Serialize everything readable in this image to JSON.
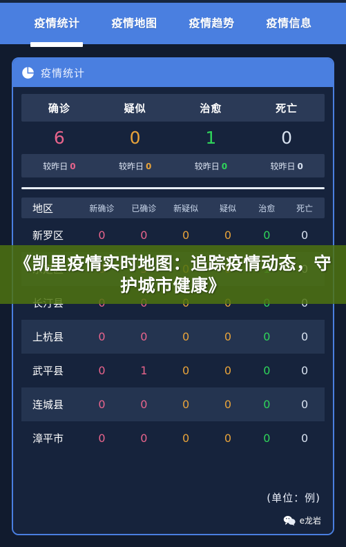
{
  "tabs": [
    {
      "label": "疫情统计",
      "active": true
    },
    {
      "label": "疫情地图",
      "active": false
    },
    {
      "label": "疫情趋势",
      "active": false
    },
    {
      "label": "疫情信息",
      "active": false
    }
  ],
  "card": {
    "header_title": "疫情统计",
    "header_icon": "pie-chart-icon"
  },
  "summary": {
    "headers": [
      "确诊",
      "疑似",
      "治愈",
      "死亡"
    ],
    "values": [
      "6",
      "0",
      "1",
      "0"
    ],
    "value_colors": [
      "#e8648c",
      "#e8a33a",
      "#2fd45a",
      "#d7e1ef"
    ],
    "delta_label": "较昨日",
    "deltas": [
      "0",
      "0",
      "0",
      "0"
    ],
    "delta_colors": [
      "#e8648c",
      "#e8a33a",
      "#2fd45a",
      "#d7e1ef"
    ]
  },
  "region_table": {
    "headers": [
      "地区",
      "新确诊",
      "已确诊",
      "新疑似",
      "疑似",
      "治愈",
      "死亡"
    ],
    "column_colors": [
      "#ffffff",
      "#e8648c",
      "#e8648c",
      "#e8a33a",
      "#e8a33a",
      "#2fd45a",
      "#d7e1ef"
    ],
    "rows": [
      {
        "region": "新罗区",
        "values": [
          "0",
          "0",
          "0",
          "0",
          "0",
          "0"
        ]
      },
      {
        "region": "永定区",
        "values": [
          "0",
          "5",
          "0",
          "0",
          "1",
          "0"
        ]
      },
      {
        "region": "长汀县",
        "values": [
          "0",
          "0",
          "0",
          "0",
          "0",
          "0"
        ]
      },
      {
        "region": "上杭县",
        "values": [
          "0",
          "0",
          "0",
          "0",
          "0",
          "0"
        ]
      },
      {
        "region": "武平县",
        "values": [
          "0",
          "1",
          "0",
          "0",
          "0",
          "0"
        ]
      },
      {
        "region": "连城县",
        "values": [
          "0",
          "0",
          "0",
          "0",
          "0",
          "0"
        ]
      },
      {
        "region": "漳平市",
        "values": [
          "0",
          "0",
          "0",
          "0",
          "0",
          "0"
        ]
      }
    ]
  },
  "footer": {
    "unit_note": "(单位：例)",
    "wechat_label": "e龙岩",
    "wechat_icon": "wechat-icon"
  },
  "overlay": {
    "title": "《凯里疫情实时地图：追踪疫情动态，守护城市健康》",
    "band_color": "#4f7310"
  },
  "theme": {
    "accent_blue": "#4a7fe0",
    "card_bg": "#16233c",
    "row_alt_bg": "#243450",
    "header_row_bg": "#2b3a57"
  }
}
